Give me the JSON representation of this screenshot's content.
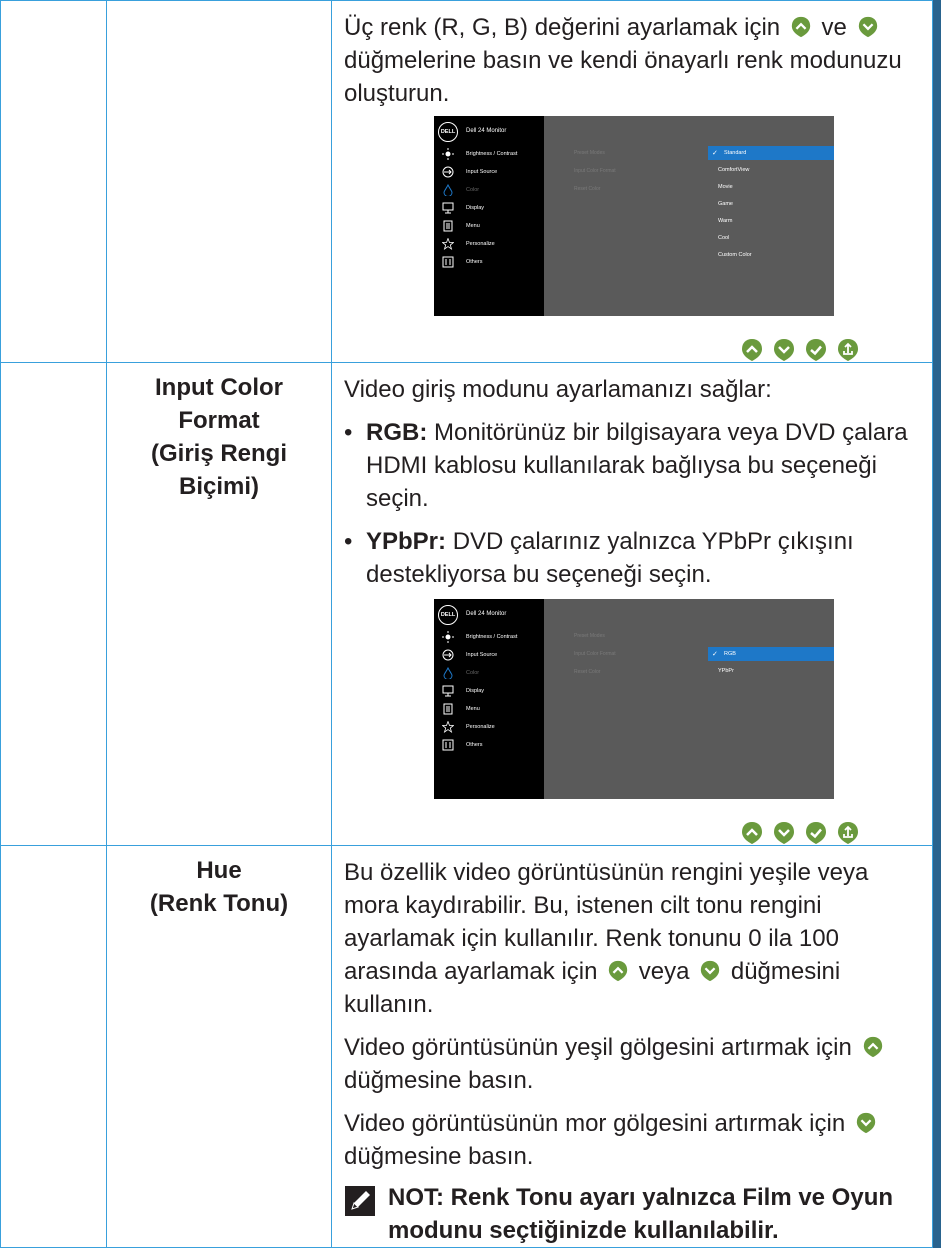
{
  "rows": [
    {
      "label_lines": [],
      "paragraph_parts": [
        "Üç renk (R, G, B) değerini ayarlamak için",
        "ve",
        "düğmelerine basın ve kendi önayarlı renk modunuzu oluşturun."
      ],
      "osd": {
        "title": "Dell 24 Monitor",
        "logo": "DELL",
        "menu": [
          "Brightness / Contrast",
          "Input Source",
          "Color",
          "Display",
          "Menu",
          "Personalize",
          "Others"
        ],
        "selected_menu": "Color",
        "submenu": [
          "Preset Modes",
          "Input Color Format",
          "Reset Color"
        ],
        "options": [
          "Standard",
          "ComfortView",
          "Movie",
          "Game",
          "Warm",
          "Cool",
          "Custom Color"
        ],
        "selected_option": "Standard"
      }
    },
    {
      "label_lines": [
        "Input Color",
        "Format",
        "(Giriş Rengi",
        "Biçimi)"
      ],
      "intro": "Video giriş modunu ayarlamanızı sağlar:",
      "bullets": [
        {
          "term": "RGB:",
          "text": "Monitörünüz bir bilgisayara veya DVD çalara HDMI kablosu kullanılarak bağlıysa bu seçeneği seçin."
        },
        {
          "term": "YPbPr:",
          "text": "DVD çalarınız yalnızca YPbPr çıkışını destekliyorsa bu seçeneği seçin."
        }
      ],
      "osd": {
        "title": "Dell 24 Monitor",
        "logo": "DELL",
        "menu": [
          "Brightness / Contrast",
          "Input Source",
          "Color",
          "Display",
          "Menu",
          "Personalize",
          "Others"
        ],
        "selected_menu": "Color",
        "submenu": [
          "Preset Modes",
          "Input Color Format",
          "Reset Color"
        ],
        "options": [
          "RGB",
          "YPbPr"
        ],
        "selected_option": "RGB"
      }
    },
    {
      "label_lines": [
        "Hue",
        "(Renk Tonu)"
      ],
      "para1_parts": [
        "Bu özellik video görüntüsünün rengini yeşile veya mora kaydırabilir. Bu, istenen cilt tonu rengini ayarlamak için kullanılır. Renk tonunu 0 ila 100 arasında ayarlamak için",
        "veya",
        "düğmesini kullanın."
      ],
      "para2_parts": [
        "Video görüntüsünün yeşil gölgesini artırmak için",
        "düğmesine basın."
      ],
      "para3_parts": [
        "Video görüntüsünün mor gölgesini artırmak için",
        "düğmesine basın."
      ],
      "note": "NOT: Renk Tonu ayarı yalnızca Film ve Oyun modunu seçtiğinizde kullanılabilir."
    }
  ],
  "colors": {
    "page_background": "#29638e",
    "table_border": "#39a0dc",
    "button_fill": "#6a9a3d",
    "osd_highlight": "#1e78c8"
  },
  "icons": [
    "up-button-icon",
    "down-button-icon",
    "check-button-icon",
    "exit-button-icon",
    "note-pencil-icon"
  ]
}
